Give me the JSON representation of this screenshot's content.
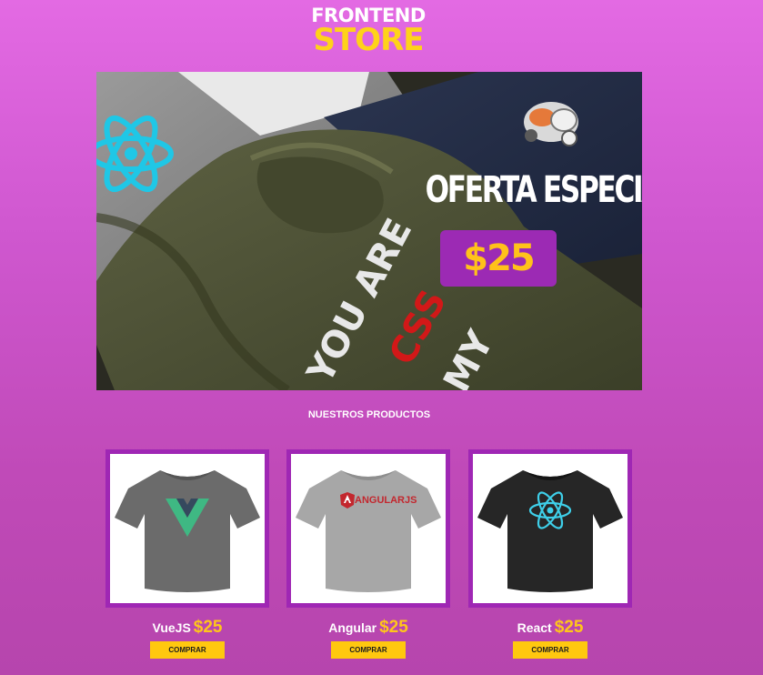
{
  "logo": {
    "line1": "FRONTEND",
    "line2": "STORE"
  },
  "hero": {
    "title": "OFERTA ESPECIAL",
    "price": "$25",
    "shirt_text": "YOU ARE",
    "shirt_css": "CSS",
    "shirt_text2": "MY"
  },
  "products_title": "NUESTROS PRODUCTOS",
  "products": [
    {
      "name": "VueJS",
      "price": "$25",
      "button": "COMPRAR",
      "shirt_color": "#6b6b6b",
      "logo": "vue-logo"
    },
    {
      "name": "Angular",
      "price": "$25",
      "button": "COMPRAR",
      "shirt_color": "#a7a7a7",
      "logo": "angular-logo",
      "shirt_text": "ANGULARJS"
    },
    {
      "name": "React",
      "price": "$25",
      "button": "COMPRAR",
      "shirt_color": "#262626",
      "logo": "react-logo"
    }
  ],
  "colors": {
    "frame": "#9f27b4",
    "accent_yellow": "#ffc80f",
    "price_badge": "#9c2ab4"
  }
}
